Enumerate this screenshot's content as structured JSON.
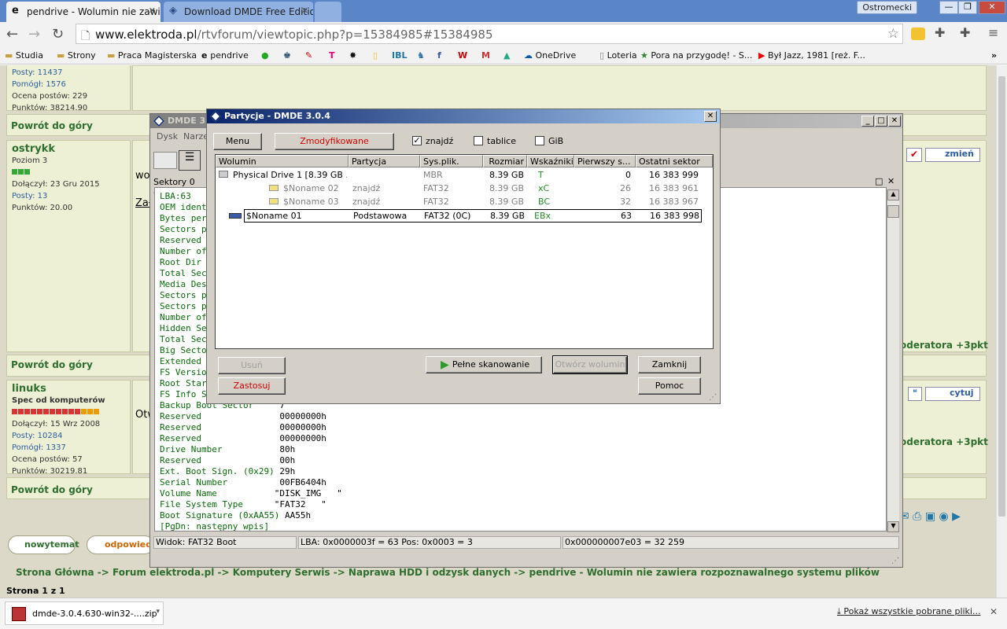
{
  "browser": {
    "tabs": [
      {
        "title": "pendrive - Wolumin nie zawi",
        "active": true
      },
      {
        "title": "Download DMDE Free Edition",
        "active": false
      },
      {
        "title": "",
        "active": false
      }
    ],
    "user": "Ostromecki",
    "url_host": "www.elektroda.pl",
    "url_rest": "/rtvforum/viewtopic.php?p=15384985#15384985",
    "bookmarks": [
      "Studia",
      "Strony",
      "Praca Magisterska",
      "pendrive",
      "OneDrive",
      "Loteria",
      "Pora na przygodę! - S...",
      "Był Jazz, 1981 [reż. F..."
    ]
  },
  "forum": {
    "post1": {
      "posty": "Posty: 11437",
      "pomogl": "Pomógł: 1576",
      "ocena": "Ocena postów: 229",
      "punkty": "Punktów: 38214.90"
    },
    "goto_top": "Powrót do góry",
    "post2": {
      "user": "ostrykk",
      "level": "Poziom 3",
      "joined": "Dołączył: 23 Gru 2015",
      "posty": "Posty: 13",
      "punkty": "Punktów: 20.00",
      "text_start": "wo",
      "link_start": "Zał"
    },
    "post3": {
      "user": "linuks",
      "level": "Spec od komputerów",
      "joined": "Dołączył: 15 Wrz 2008",
      "posty": "Posty: 10284",
      "pomogl": "Pomógł: 1337",
      "ocena": "Ocena postów: 57",
      "punkty": "Punktów: 30219.81",
      "text_start": "Otw"
    },
    "mod_link": "oderatora +3pkt",
    "zmien": "zmień",
    "cytuj": "cytuj",
    "new_topic": "nowytemat",
    "reply": "odpowiedz",
    "breadcrumb": "Strona Główna -> Forum elektroda.pl -> Komputery Serwis -> Naprawa HDD i odzysk danych -> pendrive - Wolumin nie zawiera rozpoznawalnego systemu plików",
    "page_info": "Strona 1 z 1"
  },
  "downloads": {
    "file": "dmde-3.0.4.630-win32-....zip",
    "show_all": "Pokaż wszystkie pobrane pliki..."
  },
  "dmde": {
    "title": "DMDE 3.0",
    "menu": [
      "Dysk",
      "Narzę"
    ],
    "panel_title": "Sektory 0 - 16",
    "hex_rows": [
      {
        "k": "LBA:63",
        "v": ""
      },
      {
        "k": "OEM ident",
        "v": ""
      },
      {
        "k": "Bytes per",
        "v": ""
      },
      {
        "k": "Sectors p",
        "v": ""
      },
      {
        "k": "Reserved ",
        "v": ""
      },
      {
        "k": "Number of",
        "v": ""
      },
      {
        "k": "Root Dir ",
        "v": ""
      },
      {
        "k": "Total Sec",
        "v": ""
      },
      {
        "k": "Media Des",
        "v": ""
      },
      {
        "k": "Sectors p",
        "v": ""
      },
      {
        "k": "Sectors p",
        "v": ""
      },
      {
        "k": "Number of",
        "v": ""
      },
      {
        "k": "Hidden Se",
        "v": ""
      },
      {
        "k": "Total Sec",
        "v": ""
      },
      {
        "k": "Big Secto",
        "v": ""
      },
      {
        "k": "Extended ",
        "v": ""
      },
      {
        "k": "FS Versio",
        "v": ""
      },
      {
        "k": "Root Star",
        "v": ""
      },
      {
        "k": "FS Info S",
        "v": ""
      },
      {
        "k": "Backup Boot Sector     ",
        "v": "7"
      },
      {
        "k": "Reserved               ",
        "v": "00000000h"
      },
      {
        "k": "Reserved               ",
        "v": "00000000h"
      },
      {
        "k": "Reserved               ",
        "v": "00000000h"
      },
      {
        "k": "Drive Number           ",
        "v": "80h"
      },
      {
        "k": "Reserved               ",
        "v": "00h"
      },
      {
        "k": "Ext. Boot Sign. (0x29) ",
        "v": "29h"
      },
      {
        "k": "Serial Number          ",
        "v": "00FB6404h"
      },
      {
        "k": "Volume Name           ",
        "v": "\"DISK_IMG   \""
      },
      {
        "k": "File System Type      ",
        "v": "\"FAT32   \""
      },
      {
        "k": "Boot Signature (0xAA55) ",
        "v": "AA55h"
      },
      {
        "k": "[PgDn: następny wpis]",
        "v": ""
      }
    ],
    "status": {
      "view": "Widok:  FAT32 Boot",
      "lba": "LBA: 0x0000003f = 63  Pos: 0x0003 = 3",
      "hex": "0x000000007e03 = 32 259"
    }
  },
  "dialog": {
    "title": "Partycje - DMDE 3.0.4",
    "menu_btn": "Menu",
    "modified_btn": "Zmodyfikowane",
    "chk_find": "znajdź",
    "chk_tables": "tablice",
    "chk_gib": "GiB",
    "columns": [
      "Wolumin",
      "Partycja",
      "Sys.plik.",
      "Rozmiar",
      "Wskaźniki",
      "Pierwszy s...",
      "Ostatni sektor"
    ],
    "rows": [
      {
        "vol": "Physical Drive 1 [8.39 GB ...",
        "part": "",
        "fs": "MBR",
        "size": "8.39 GB",
        "flags": "T",
        "first": "0",
        "last": "16 383 999"
      },
      {
        "vol": "$Noname 02",
        "part": "znajdź",
        "fs": "FAT32",
        "size": "8.39 GB",
        "flags": "xC",
        "first": "26",
        "last": "16 383 961"
      },
      {
        "vol": "$Noname 03",
        "part": "znajdź",
        "fs": "FAT32",
        "size": "8.39 GB",
        "flags": "BC",
        "first": "32",
        "last": "16 383 967"
      },
      {
        "vol": "$Noname 01",
        "part": "Podstawowa",
        "fs": "FAT32 (0C)",
        "size": "8.39 GB",
        "flags": "EBx",
        "first": "63",
        "last": "16 383 998"
      }
    ],
    "btn_delete": "Usuń",
    "btn_apply": "Zastosuj",
    "btn_full_scan": "Pełne skanowanie",
    "btn_open_vol": "Otwórz wolumin",
    "btn_close": "Zamknij",
    "btn_help": "Pomoc"
  },
  "colors": {
    "forum_green": "#2e6e2e",
    "title_blue": "#0a246a",
    "red_text": "#d00000"
  }
}
